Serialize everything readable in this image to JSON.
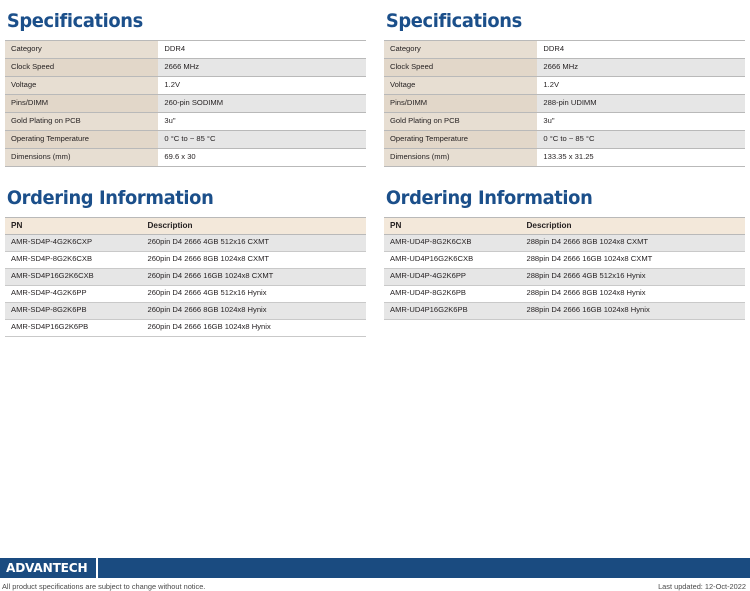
{
  "left": {
    "specifications": {
      "title": "Specifications",
      "rows": [
        {
          "key": "Category",
          "value": "DDR4"
        },
        {
          "key": "Clock Speed",
          "value": "2666 MHz"
        },
        {
          "key": "Voltage",
          "value": "1.2V"
        },
        {
          "key": "Pins/DIMM",
          "value": "260-pin SODIMM"
        },
        {
          "key": "Gold Plating on PCB",
          "value": "3u\""
        },
        {
          "key": "Operating Temperature",
          "value": "0 °C to ~ 85 °C"
        },
        {
          "key": "Dimensions (mm)",
          "value": "69.6 x 30"
        }
      ]
    },
    "ordering": {
      "title": "Ordering Information",
      "headers": {
        "pn": "PN",
        "description": "Description"
      },
      "rows": [
        {
          "pn": "AMR-SD4P-4G2K6CXP",
          "description": "260pin D4 2666 4GB  512x16 CXMT"
        },
        {
          "pn": "AMR-SD4P-8G2K6CXB",
          "description": "260pin D4 2666 8GB 1024x8 CXMT"
        },
        {
          "pn": "AMR-SD4P16G2K6CXB",
          "description": "260pin D4 2666 16GB 1024x8 CXMT"
        },
        {
          "pn": "AMR-SD4P-4G2K6PP",
          "description": "260pin D4 2666 4GB 512x16 Hynix"
        },
        {
          "pn": "AMR-SD4P-8G2K6PB",
          "description": "260pin D4 2666 8GB 1024x8 Hynix"
        },
        {
          "pn": "AMR-SD4P16G2K6PB",
          "description": "260pin D4 2666 16GB 1024x8 Hynix"
        }
      ]
    }
  },
  "right": {
    "specifications": {
      "title": "Specifications",
      "rows": [
        {
          "key": "Category",
          "value": "DDR4"
        },
        {
          "key": "Clock Speed",
          "value": "2666 MHz"
        },
        {
          "key": "Voltage",
          "value": "1.2V"
        },
        {
          "key": "Pins/DIMM",
          "value": "288-pin UDIMM"
        },
        {
          "key": "Gold Plating on PCB",
          "value": "3u\""
        },
        {
          "key": "Operating Temperature",
          "value": "0 °C to ~ 85 °C"
        },
        {
          "key": "Dimensions (mm)",
          "value": "133.35 x 31.25"
        }
      ]
    },
    "ordering": {
      "title": "Ordering Information",
      "headers": {
        "pn": "PN",
        "description": "Description"
      },
      "rows": [
        {
          "pn": "AMR-UD4P-8G2K6CXB",
          "description": "288pin D4 2666 8GB 1024x8 CXMT"
        },
        {
          "pn": "AMR-UD4P16G2K6CXB",
          "description": "288pin D4 2666 16GB 1024x8 CXMT"
        },
        {
          "pn": "AMR-UD4P-4G2K6PP",
          "description": "288pin D4 2666 4GB 512x16 Hynix"
        },
        {
          "pn": "AMR-UD4P-8G2K6PB",
          "description": "288pin D4 2666 8GB 1024x8 Hynix"
        },
        {
          "pn": "AMR-UD4P16G2K6PB",
          "description": "288pin D4 2666 16GB 1024x8 Hynix"
        }
      ]
    }
  },
  "footer": {
    "logo_text": "ADVANTECH",
    "disclaimer": "All product specifications are subject to change without notice.",
    "last_updated": "Last updated: 12-Oct-2022"
  },
  "colors": {
    "heading_blue": "#1b4f8a",
    "footer_bar_blue": "#1a4b80",
    "spec_key_beige": "#e7ded2",
    "order_header_beige": "#f3e8da",
    "row_alt_gray": "#e6e6e6",
    "rule_gray": "#b9b9b9"
  }
}
